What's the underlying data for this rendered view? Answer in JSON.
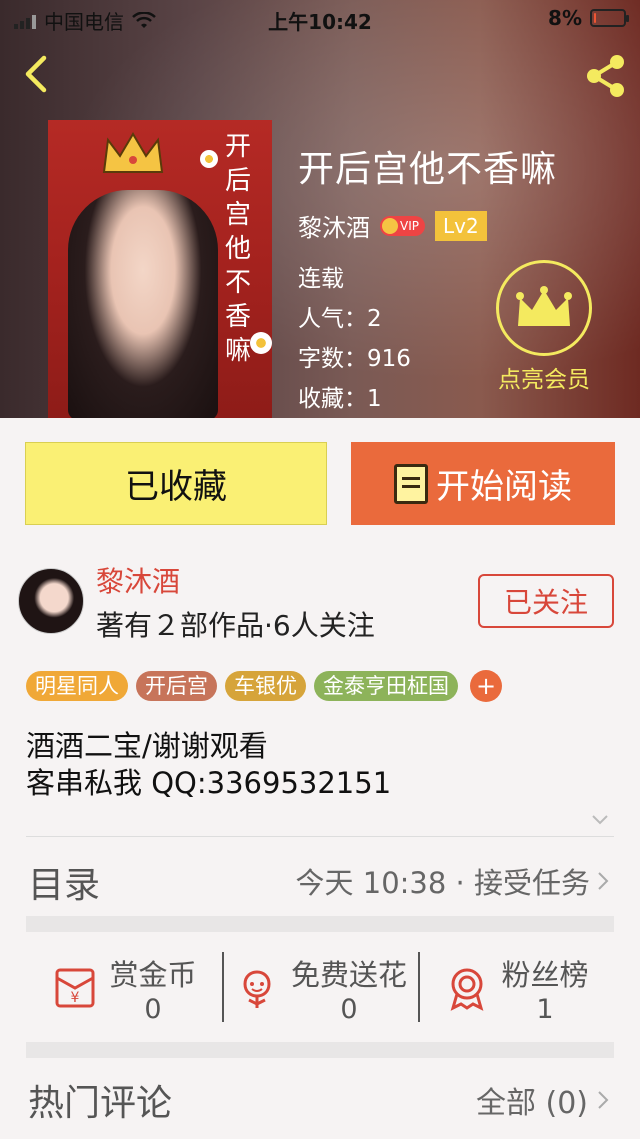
{
  "status_bar": {
    "carrier": "中国电信",
    "time": "上午10:42",
    "battery": "8%",
    "battery_level": 0.08
  },
  "book": {
    "title": "开后宫他不香嘛",
    "cover_title": [
      "开",
      "后",
      "宫",
      "他",
      "不",
      "香",
      "嘛"
    ],
    "author": "黎沐酒",
    "vip_label": "VIP",
    "level": "Lv2",
    "status": "连载",
    "popularity": "人气：2",
    "word_count": "字数：916",
    "favorites": "收藏：1"
  },
  "member": {
    "label": "点亮会员"
  },
  "actions": {
    "favorited_label": "已收藏",
    "start_reading_label": "开始阅读"
  },
  "author_card": {
    "name": "黎沐酒",
    "summary": "著有２部作品·6人关注",
    "follow_label": "已关注"
  },
  "tags": [
    {
      "label": "明星同人",
      "color": "#f0a837"
    },
    {
      "label": "开后宫",
      "color": "#c7745a"
    },
    {
      "label": "车银优",
      "color": "#d6a43a"
    },
    {
      "label": "金泰亨田柾国",
      "color": "#8db35a"
    }
  ],
  "tag_add": "+",
  "description": [
    "酒酒二宝/谢谢观看",
    "客串私我 QQ:3369532151"
  ],
  "toc": {
    "title": "目录",
    "update": "今天 10:38 · 接受任务"
  },
  "rewards": [
    {
      "label": "赏金币",
      "value": "0",
      "icon": "red-envelope-icon"
    },
    {
      "label": "免费送花",
      "value": "0",
      "icon": "flower-icon"
    },
    {
      "label": "粉丝榜",
      "value": "1",
      "icon": "medal-icon"
    }
  ],
  "comments": {
    "title": "热门评论",
    "all_label": "全部 (0)"
  },
  "colors": {
    "accent": "#ea6a3c",
    "favorite_bg": "#faf074",
    "author_red": "#d8473a",
    "member_yellow": "#f4ea5f",
    "icon_red": "#d8473a"
  }
}
